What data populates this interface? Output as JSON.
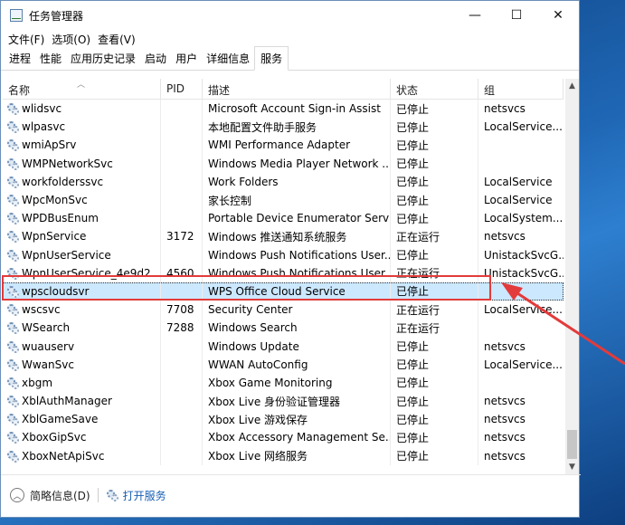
{
  "window": {
    "title": "任务管理器",
    "controls": {
      "minimize": "—",
      "maximize": "☐",
      "close": "✕"
    }
  },
  "menu": [
    "文件(F)",
    "选项(O)",
    "查看(V)"
  ],
  "tabs": [
    "进程",
    "性能",
    "应用历史记录",
    "启动",
    "用户",
    "详细信息",
    "服务"
  ],
  "active_tab": "服务",
  "columns": [
    "名称",
    "PID",
    "描述",
    "状态",
    "组"
  ],
  "rows": [
    {
      "name": "wlidsvc",
      "pid": "",
      "desc": "Microsoft Account Sign-in Assist",
      "state": "已停止",
      "group": "netsvcs"
    },
    {
      "name": "wlpasvc",
      "pid": "",
      "desc": "本地配置文件助手服务",
      "state": "已停止",
      "group": "LocalService..."
    },
    {
      "name": "wmiApSrv",
      "pid": "",
      "desc": "WMI Performance Adapter",
      "state": "已停止",
      "group": ""
    },
    {
      "name": "WMPNetworkSvc",
      "pid": "",
      "desc": "Windows Media Player Network ...",
      "state": "已停止",
      "group": ""
    },
    {
      "name": "workfolderssvc",
      "pid": "",
      "desc": "Work Folders",
      "state": "已停止",
      "group": "LocalService"
    },
    {
      "name": "WpcMonSvc",
      "pid": "",
      "desc": "家长控制",
      "state": "已停止",
      "group": "LocalService"
    },
    {
      "name": "WPDBusEnum",
      "pid": "",
      "desc": "Portable Device Enumerator Serv",
      "state": "已停止",
      "group": "LocalSystem..."
    },
    {
      "name": "WpnService",
      "pid": "3172",
      "desc": "Windows 推送通知系统服务",
      "state": "正在运行",
      "group": "netsvcs"
    },
    {
      "name": "WpnUserService",
      "pid": "",
      "desc": "Windows Push Notifications User...",
      "state": "已停止",
      "group": "UnistackSvcG..."
    },
    {
      "name": "WpnUserService_4e9d2",
      "pid": "4560",
      "desc": "Windows Push Notifications User...",
      "state": "正在运行",
      "group": "UnistackSvcG..."
    },
    {
      "name": "wpscloudsvr",
      "pid": "",
      "desc": "WPS Office Cloud Service",
      "state": "已停止",
      "group": ""
    },
    {
      "name": "wscsvc",
      "pid": "7708",
      "desc": "Security Center",
      "state": "正在运行",
      "group": "LocalService..."
    },
    {
      "name": "WSearch",
      "pid": "7288",
      "desc": "Windows Search",
      "state": "正在运行",
      "group": ""
    },
    {
      "name": "wuauserv",
      "pid": "",
      "desc": "Windows Update",
      "state": "已停止",
      "group": "netsvcs"
    },
    {
      "name": "WwanSvc",
      "pid": "",
      "desc": "WWAN AutoConfig",
      "state": "已停止",
      "group": "LocalService..."
    },
    {
      "name": "xbgm",
      "pid": "",
      "desc": "Xbox Game Monitoring",
      "state": "已停止",
      "group": ""
    },
    {
      "name": "XblAuthManager",
      "pid": "",
      "desc": "Xbox Live 身份验证管理器",
      "state": "已停止",
      "group": "netsvcs"
    },
    {
      "name": "XblGameSave",
      "pid": "",
      "desc": "Xbox Live 游戏保存",
      "state": "已停止",
      "group": "netsvcs"
    },
    {
      "name": "XboxGipSvc",
      "pid": "",
      "desc": "Xbox Accessory Management Se...",
      "state": "已停止",
      "group": "netsvcs"
    },
    {
      "name": "XboxNetApiSvc",
      "pid": "",
      "desc": "Xbox Live 网络服务",
      "state": "已停止",
      "group": "netsvcs"
    }
  ],
  "selected_row": "wpscloudsvr",
  "footer": {
    "fewer_details": "简略信息(D)",
    "open_services": "打开服务"
  },
  "colors": {
    "highlight": "#e33b3b",
    "selection": "#cce8ff",
    "link": "#1a5fb4"
  }
}
